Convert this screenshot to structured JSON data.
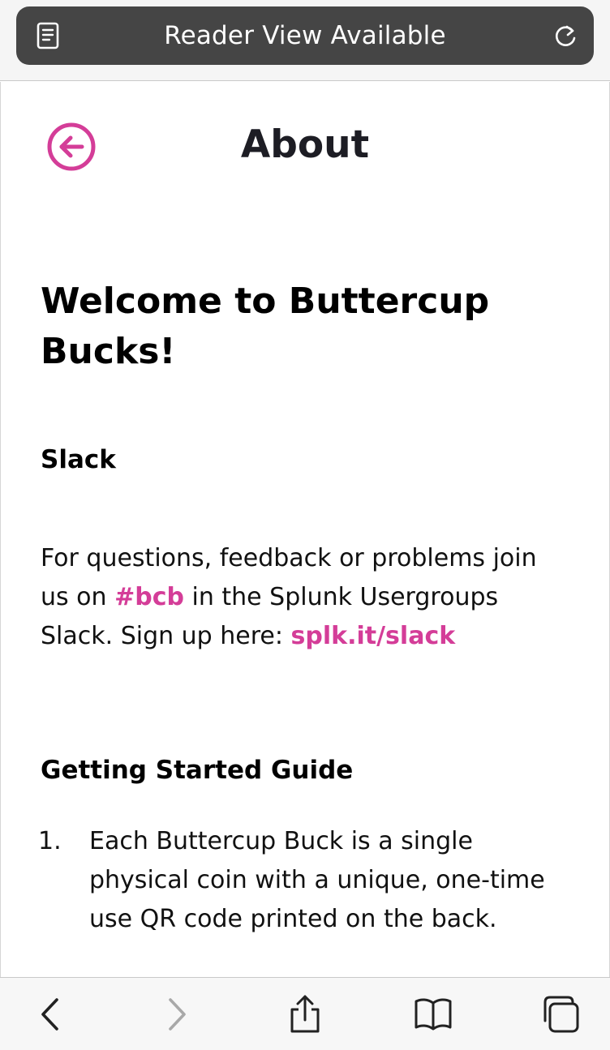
{
  "browser": {
    "reader_view_text": "Reader View Available",
    "icons": {
      "reader": "reader-view-icon",
      "reload": "reload-icon"
    }
  },
  "header": {
    "title": "About",
    "back_icon": "circle-arrow-left-icon"
  },
  "content": {
    "welcome": "Welcome to Buttercup Bucks!",
    "slack": {
      "heading": "Slack",
      "text_1": "For questions, feedback or problems join us on ",
      "channel_link": "#bcb",
      "text_2": " in the Splunk Usergroups Slack. Sign up here: ",
      "signup_link": "splk.it/slack"
    },
    "guide": {
      "heading": "Getting Started Guide",
      "items": [
        {
          "number": "1.",
          "text": "Each Buttercup Buck is a single physical coin with a unique, one-time use QR code printed on the back."
        }
      ]
    }
  },
  "toolbar": {
    "back_icon": "chevron-left-icon",
    "forward_icon": "chevron-right-icon",
    "share_icon": "share-icon",
    "bookmarks_icon": "book-icon",
    "tabs_icon": "tabs-icon"
  },
  "colors": {
    "accent_pink": "#d43d98",
    "reader_bar": "#454545",
    "toolbar_blue_gray": "#222222",
    "disabled_gray": "#a8a8a8"
  }
}
